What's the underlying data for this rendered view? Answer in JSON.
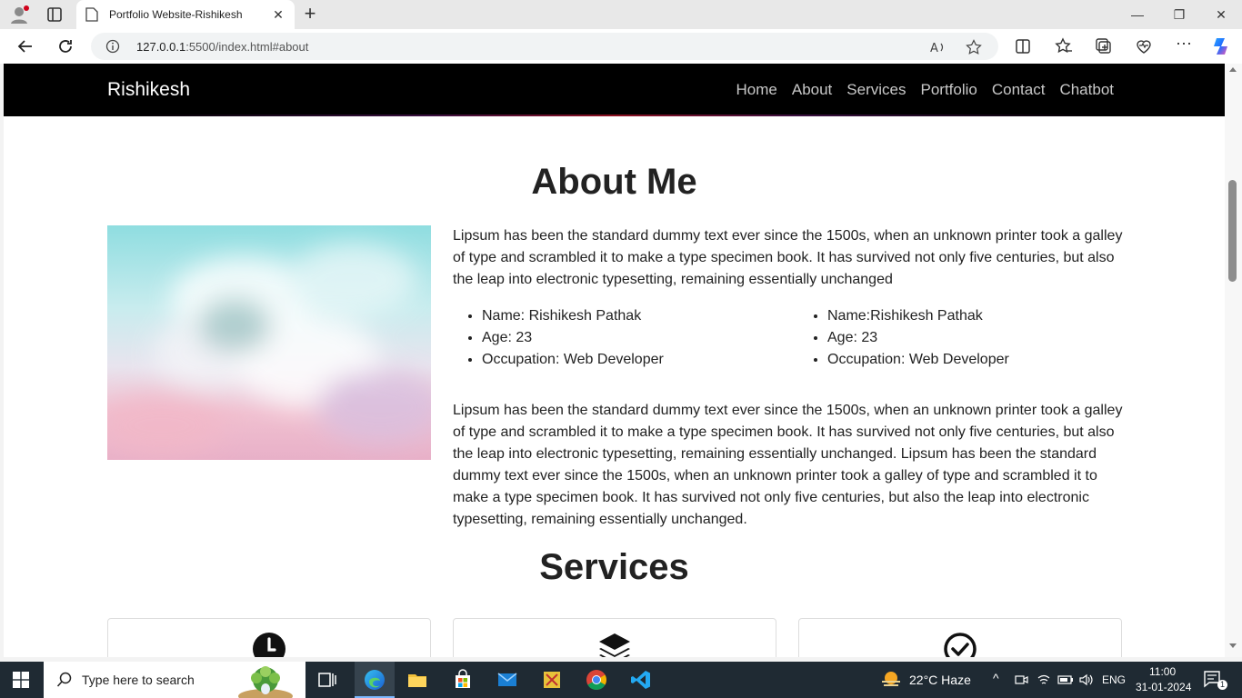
{
  "browser": {
    "tab_title": "Portfolio Website-Rishikesh",
    "url_host": "127.0.0.1",
    "url_path": ":5500/index.html#about"
  },
  "site": {
    "brand": "Rishikesh",
    "nav": [
      "Home",
      "About",
      "Services",
      "Portfolio",
      "Contact",
      "Chatbot"
    ]
  },
  "about": {
    "title": "About Me",
    "intro": "Lipsum has been the standard dummy text ever since the 1500s, when an unknown printer took a galley of type and scrambled it to make a type specimen book. It has survived not only five centuries, but also the leap into electronic typesetting, remaining essentially unchanged",
    "list_left": [
      "Name: Rishikesh Pathak",
      "Age: 23",
      "Occupation: Web Developer"
    ],
    "list_right": [
      "Name:Rishikesh Pathak",
      "Age: 23",
      "Occupation: Web Developer"
    ],
    "body": "Lipsum has been the standard dummy text ever since the 1500s, when an unknown printer took a galley of type and scrambled it to make a type specimen book. It has survived not only five centuries, but also the leap into electronic typesetting, remaining essentially unchanged. Lipsum has been the standard dummy text ever since the 1500s, when an unknown printer took a galley of type and scrambled it to make a type specimen book. It has survived not only five centuries, but also the leap into electronic typesetting, remaining essentially unchanged."
  },
  "services": {
    "title": "Services",
    "icons": [
      "clock-icon",
      "layers-icon",
      "check-circle-icon"
    ]
  },
  "taskbar": {
    "search_placeholder": "Type here to search",
    "weather": "22°C  Haze",
    "lang": "ENG",
    "time": "11:00",
    "date": "31-01-2024",
    "notifications": "1"
  }
}
